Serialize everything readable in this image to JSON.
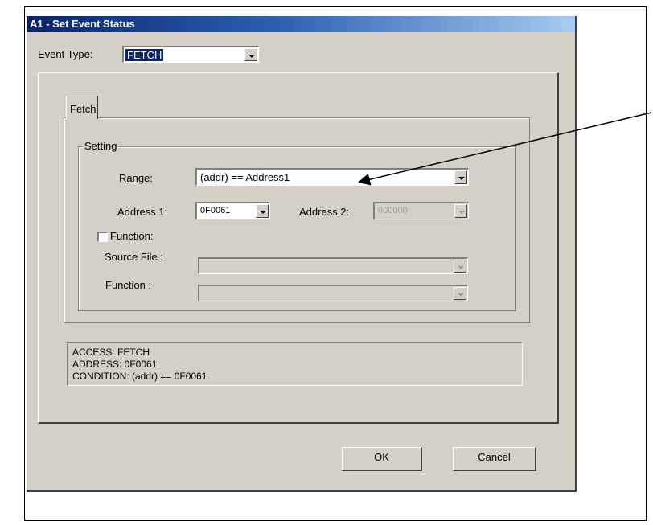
{
  "dialog": {
    "title": "A1 - Set Event Status"
  },
  "event_type": {
    "label": "Event Type:",
    "value": "FETCH"
  },
  "tab": {
    "label": "Fetch"
  },
  "setting": {
    "legend": "Setting",
    "range_label": "Range:",
    "range_value": "(addr) == Address1",
    "address1_label": "Address 1:",
    "address1_value": "0F0061",
    "address2_label": "Address 2:",
    "address2_value": "000000",
    "function_checkbox_label": "Function:",
    "function_checked": false,
    "source_file_label": "Source File :",
    "source_file_value": "",
    "function_label": "Function :",
    "function_value": ""
  },
  "info": {
    "lines": [
      "ACCESS: FETCH",
      "ADDRESS: 0F0061",
      "CONDITION: (addr) == 0F0061"
    ]
  },
  "buttons": {
    "ok": "OK",
    "cancel": "Cancel"
  },
  "icons": {
    "dropdown": "chevron-down-icon",
    "callout": "arrow-callout"
  }
}
